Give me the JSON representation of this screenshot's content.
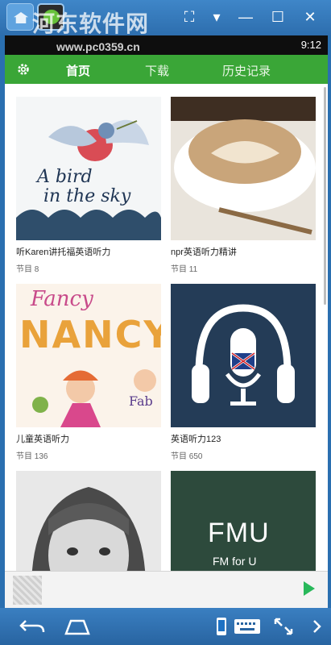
{
  "window": {
    "watermark": "河东软件网",
    "watermark_url": "www.pc0359.cn"
  },
  "status": {
    "time": "9:12"
  },
  "toolbar": {
    "tabs": [
      {
        "label": "首页",
        "active": true
      },
      {
        "label": "下载",
        "active": false
      },
      {
        "label": "历史记录",
        "active": false
      }
    ]
  },
  "cards": [
    {
      "title": "听Karen讲托福英语听力",
      "count": "节目 8",
      "cover_text": [
        "A bird",
        "in the sky"
      ]
    },
    {
      "title": "npr英语听力精讲",
      "count": "节目 11"
    },
    {
      "title": "儿童英语听力",
      "count": "节目 136",
      "cover_text": [
        "Fancy",
        "NANCY",
        "Fab"
      ]
    },
    {
      "title": "英语听力123",
      "count": "节目 650"
    },
    {
      "title": "",
      "count": ""
    },
    {
      "title": "",
      "count": "",
      "cover_text": [
        "FMU",
        "FM for U"
      ]
    }
  ],
  "colors": {
    "accent": "#3aa637",
    "play": "#28b85a",
    "emulator_chrome": "#2d6eae"
  }
}
